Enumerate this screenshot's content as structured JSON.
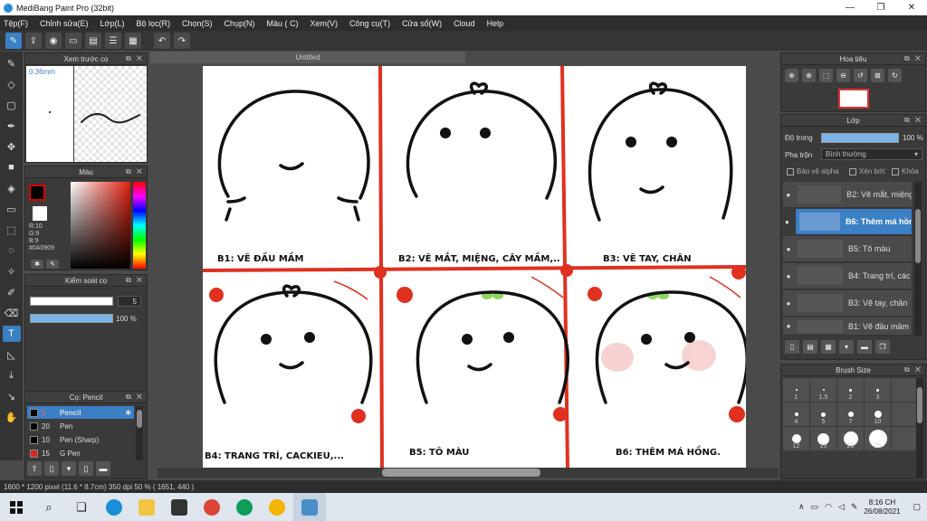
{
  "app": {
    "title": "MediBang Paint Pro (32bit)"
  },
  "window_buttons": {
    "minimize": "—",
    "maximize": "❐",
    "close": "✕"
  },
  "menu": [
    "Tệp(F)",
    "Chỉnh sửa(E)",
    "Lớp(L)",
    "Bộ lọc(R)",
    "Chọn(S)",
    "Chụp(N)",
    "Màu ( C)",
    "Xem(V)",
    "Công cụ(T)",
    "Cửa sổ(W)",
    "Cloud",
    "Help"
  ],
  "toolbar": {
    "icons": [
      "pen-tool-icon",
      "share-icon",
      "comment-icon",
      "message-icon",
      "document-icon",
      "panel-icon",
      "grid-icon",
      "undo-icon",
      "redo-icon"
    ],
    "undo": "↶",
    "redo": "↷"
  },
  "brush_preview": {
    "title": "Xem trước cọ",
    "size": "0.36mm"
  },
  "color_panel": {
    "title": "Màu",
    "r": "R:10",
    "g": "G:9",
    "b": "B:9",
    "hex": "#0A0909",
    "fg_color": "#0A0909"
  },
  "control_panel": {
    "title": "Kiểm soát cọ",
    "size_value": "5",
    "size_fill": 1.0,
    "opacity_value": "100 %",
    "opacity_fill": 1.0
  },
  "brush_panel": {
    "title": "Cọ: Pencil",
    "items": [
      {
        "size": "5",
        "name": "Pencil",
        "color": "#000000",
        "selected": true
      },
      {
        "size": "20",
        "name": "Pen",
        "color": "#000000",
        "selected": false
      },
      {
        "size": "10",
        "name": "Pen (Sharp)",
        "color": "#000000",
        "selected": false
      },
      {
        "size": "15",
        "name": "G Pen",
        "color": "#dd2222",
        "selected": false
      }
    ]
  },
  "canvas": {
    "tab": "Untitled",
    "captions": [
      "B1: VẼ ĐẦU MẦM",
      "B2: VẼ MẮT, MIỆNG, CÂY MẦM,..",
      "B3: VẼ TAY, CHÂN",
      "B4: TRANG TRÍ,  CACKIEU,...",
      "B5: TÔ MÀU",
      "B6: THÊM MÁ HỒNG."
    ]
  },
  "navigator": {
    "title": "Hoa tiêu",
    "icons": [
      "zoom-in-icon",
      "zoom-in-2-icon",
      "fit-icon",
      "zoom-out-icon",
      "rotate-left-icon",
      "reset-icon",
      "rotate-right-icon"
    ]
  },
  "layer_panel": {
    "title": "Lớp",
    "opacity_label": "Độ trong",
    "opacity_value": "100 %",
    "blend_label": "Pha trộn",
    "blend_value": "Bình thường",
    "alpha_lock": "Bảo vệ alpha",
    "clipping": "Xén bớt",
    "lock": "Khóa",
    "layers": [
      {
        "name": "B2: Vẽ mắt, miệng",
        "selected": false
      },
      {
        "name": "B6: Thêm má hồng",
        "selected": true
      },
      {
        "name": "B5: Tô màu",
        "selected": false
      },
      {
        "name": "B4: Trang trí,  các",
        "selected": false
      },
      {
        "name": "B3: Vẽ tay, chân",
        "selected": false
      },
      {
        "name": "B1: Vẽ đầu mầm",
        "selected": false
      }
    ]
  },
  "brush_size": {
    "title": "Brush Size",
    "sizes": [
      "1",
      "1.5",
      "2",
      "3",
      "",
      "4",
      "5",
      "7",
      "10",
      "",
      "12",
      "15",
      "20",
      "25",
      ""
    ]
  },
  "status": {
    "text": "1600 * 1200 pixel   (11.6 * 8.7cm)   350 dpi   50 %   ( 1651, 440 )"
  },
  "taskbar": {
    "time": "8:16 CH",
    "date": "26/08/2021"
  }
}
